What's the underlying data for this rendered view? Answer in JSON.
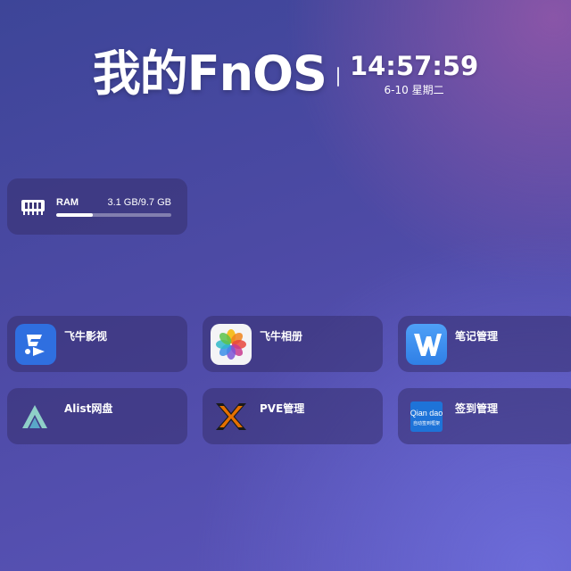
{
  "header": {
    "title": "我的FnOS",
    "time": "14:57:59",
    "date": "6-10 星期二"
  },
  "ram": {
    "label": "RAM",
    "value": "3.1 GB/9.7 GB",
    "usage_fraction": 0.32,
    "icon": "ram-chip-icon"
  },
  "apps": [
    {
      "name": "飞牛影视",
      "icon": "fn-video-icon",
      "color": "#2f6fe0"
    },
    {
      "name": "飞牛相册",
      "icon": "photos-flower-icon",
      "color": "#f4f4f6"
    },
    {
      "name": "笔记管理",
      "icon": "notes-w-icon",
      "color": "#3b8df0"
    },
    {
      "name": "Alist网盘",
      "icon": "alist-icon",
      "color": "#8fcfc8"
    },
    {
      "name": "PVE管理",
      "icon": "proxmox-x-icon",
      "color": "#e57000"
    },
    {
      "name": "签到管理",
      "icon": "qiandao-icon",
      "color": "#1e73d8",
      "icon_text_top": "Qian dao",
      "icon_text_bottom": "自动签到框架"
    }
  ]
}
